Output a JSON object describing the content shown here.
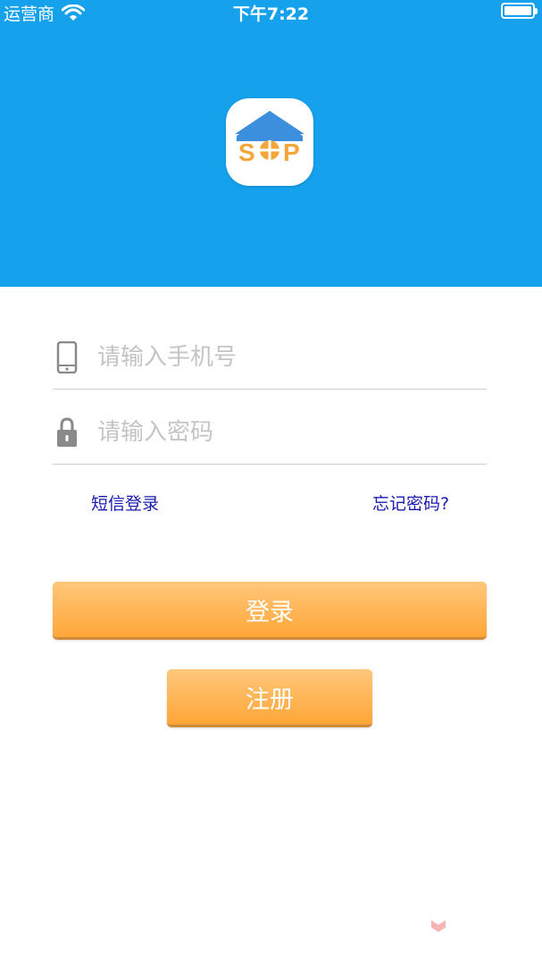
{
  "status_bar": {
    "carrier": "运营商",
    "time": "下午7:22",
    "battery_level": 1.0
  },
  "header": {
    "bg_color": "#16a1ec",
    "logo": {
      "letters": [
        "S",
        "P"
      ],
      "icon": "house-logo-icon"
    }
  },
  "form": {
    "phone": {
      "placeholder": "请输入手机号",
      "value": "",
      "icon": "phone-icon"
    },
    "password": {
      "placeholder": "请输入密码",
      "value": "",
      "icon": "lock-icon"
    },
    "sms_login_label": "短信登录",
    "forgot_label": "忘记密码?"
  },
  "buttons": {
    "login_label": "登录",
    "register_label": "注册",
    "color_top": "#ffc77a",
    "color_bottom": "#ffa638"
  }
}
